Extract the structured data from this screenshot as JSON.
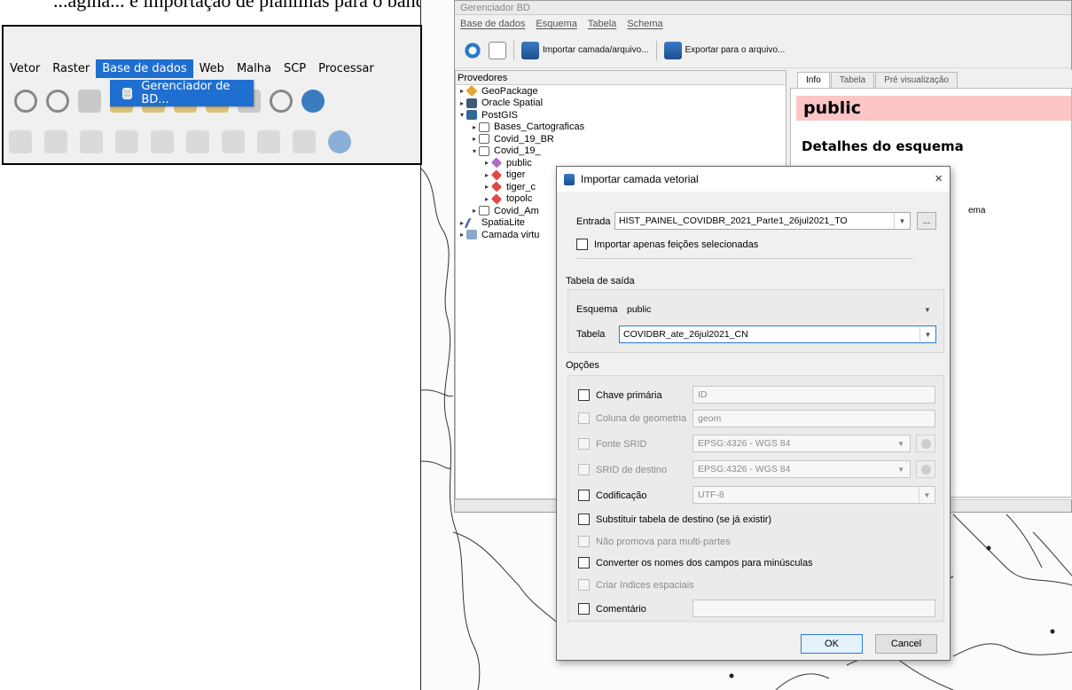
{
  "caption": "...agina... e importação de planilhas para o banco de dados... QGIS e PostgreSQL",
  "inset": {
    "menu": [
      "Vetor",
      "Raster",
      "Base de dados",
      "Web",
      "Malha",
      "SCP",
      "Processar"
    ],
    "active_menu": "Base de dados",
    "dropdown_item": "Gerenciador de BD..."
  },
  "dbmanager": {
    "title": "Gerenciador BD",
    "menu": [
      "Base de dados",
      "Esquema",
      "Tabela",
      "Schema"
    ],
    "toolbar": {
      "import_label": "Importar camada/arquivo...",
      "export_label": "Exportar para o arquivo..."
    },
    "providers_header": "Provedores",
    "tree": [
      {
        "label": "GeoPackage",
        "arrow": "▸",
        "icon": "geopackage-icon",
        "indent": 0
      },
      {
        "label": "Oracle Spatial",
        "arrow": "▸",
        "icon": "oracle-icon",
        "indent": 0
      },
      {
        "label": "PostGIS",
        "arrow": "▾",
        "icon": "postgis-icon",
        "indent": 0
      },
      {
        "label": "Bases_Cartograficas",
        "arrow": "▸",
        "icon": "database-icon",
        "indent": 1
      },
      {
        "label": "Covid_19_BR",
        "arrow": "▸",
        "icon": "database-icon",
        "indent": 1
      },
      {
        "label": "Covid_19_",
        "arrow": "▾",
        "icon": "database-icon",
        "indent": 1
      },
      {
        "label": "public",
        "arrow": "▸",
        "icon": "schema-icon",
        "indent": 2
      },
      {
        "label": "tiger",
        "arrow": "▸",
        "icon": "schema-icon",
        "indent": 2
      },
      {
        "label": "tiger_c",
        "arrow": "▸",
        "icon": "schema-icon",
        "indent": 2
      },
      {
        "label": "topolc",
        "arrow": "▸",
        "icon": "schema-icon",
        "indent": 2
      },
      {
        "label": "Covid_Am",
        "arrow": "▸",
        "icon": "database-icon",
        "indent": 1
      },
      {
        "label": "SpatiaLite",
        "arrow": "▸",
        "icon": "spatialite-icon",
        "indent": 0
      },
      {
        "label": "Camada virtu",
        "arrow": "▸",
        "icon": "virtual-layer-icon",
        "indent": 0
      }
    ],
    "tabs": [
      "Info",
      "Tabela",
      "Pré visualização"
    ],
    "info_title": "public",
    "info_subtitle": "Detalhes do esquema",
    "info_fragment": "ema"
  },
  "dialog": {
    "title": "Importar camada vetorial",
    "close": "×",
    "input_label": "Entrada",
    "input_value": "HIST_PAINEL_COVIDBR_2021_Parte1_26jul2021_TO",
    "browse_label": "...",
    "selected_only_label": "Importar apenas feições selecionadas",
    "output_section": "Tabela de saída",
    "schema_label": "Esquema",
    "schema_value": "public",
    "table_label": "Tabela",
    "table_value": "COVIDBR_ate_26jul2021_CN",
    "options_section": "Opções",
    "options": [
      {
        "label": "Chave primária",
        "value": "ID",
        "enabled": true,
        "kind": "text"
      },
      {
        "label": "Coluna de geometria",
        "value": "geom",
        "enabled": false,
        "kind": "text"
      },
      {
        "label": "Fonte SRID",
        "value": "EPSG:4326 - WGS 84",
        "enabled": false,
        "kind": "crs"
      },
      {
        "label": "SRID de destino",
        "value": "EPSG:4326 - WGS 84",
        "enabled": false,
        "kind": "crs"
      },
      {
        "label": "Codificação",
        "value": "UTF-8",
        "enabled": true,
        "kind": "select"
      }
    ],
    "flags": [
      {
        "label": "Substituir tabela de destino (se já existir)",
        "enabled": true
      },
      {
        "label": "Não promova para multi-partes",
        "enabled": false
      },
      {
        "label": "Converter os nomes dos campos para minúsculas",
        "enabled": true
      },
      {
        "label": "Criar índices espaciais",
        "enabled": false
      }
    ],
    "comment_label": "Comentário",
    "comment_value": "",
    "ok_label": "OK",
    "cancel_label": "Cancel"
  },
  "colors": {
    "menu_highlight": "#1f6fd0",
    "info_title_bg": "#fcc6c6",
    "focus_border": "#2a7bd6"
  }
}
